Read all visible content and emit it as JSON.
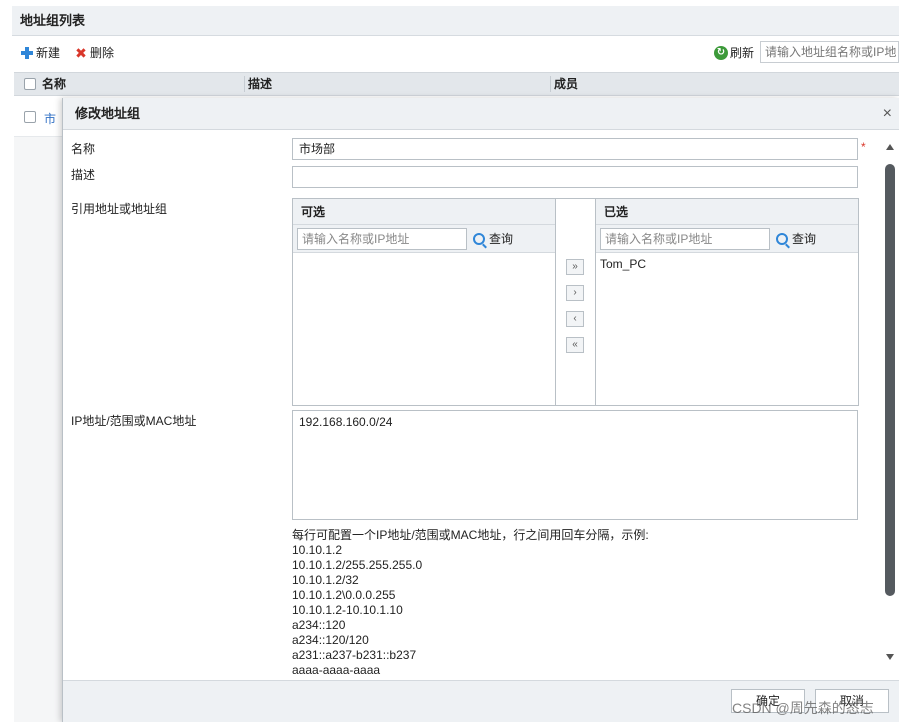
{
  "background": {
    "title": "地址组列表",
    "toolbar": {
      "new_label": "新建",
      "delete_label": "删除",
      "refresh_label": "刷新",
      "search_placeholder": "请输入地址组名称或IP地"
    },
    "table": {
      "columns": [
        "名称",
        "描述",
        "成员"
      ],
      "rows": [
        {
          "name": "市"
        }
      ]
    }
  },
  "modal": {
    "title": "修改地址组",
    "close_glyph": "×",
    "fields": {
      "name_label": "名称",
      "name_value": "市场部",
      "required_mark": "*",
      "desc_label": "描述",
      "desc_value": "",
      "ref_label": "引用地址或地址组",
      "ip_label": "IP地址/范围或MAC地址"
    },
    "available": {
      "header": "可选",
      "search_placeholder": "请输入名称或IP地址",
      "query_label": "查询",
      "items": []
    },
    "selected": {
      "header": "已选",
      "search_placeholder": "请输入名称或IP地址",
      "query_label": "查询",
      "items": [
        "Tom_PC"
      ]
    },
    "transfer_buttons": {
      "add_all": "»",
      "add": "›",
      "remove": "‹",
      "remove_all": "«"
    },
    "ip_value": "192.168.160.0/24",
    "hint_lines": [
      "每行可配置一个IP地址/范围或MAC地址，行之间用回车分隔，示例:",
      "10.10.1.2",
      "10.10.1.2/255.255.255.0",
      "10.10.1.2/32",
      "10.10.1.2\\0.0.0.255",
      "10.10.1.2-10.10.1.10",
      "a234::120",
      "a234::120/120",
      "a231::a237-b231::b237",
      "aaaa-aaaa-aaaa"
    ],
    "footer": {
      "ok_label": "确定",
      "cancel_label": "取消"
    }
  },
  "watermark": "CSDN @周先森的态志"
}
